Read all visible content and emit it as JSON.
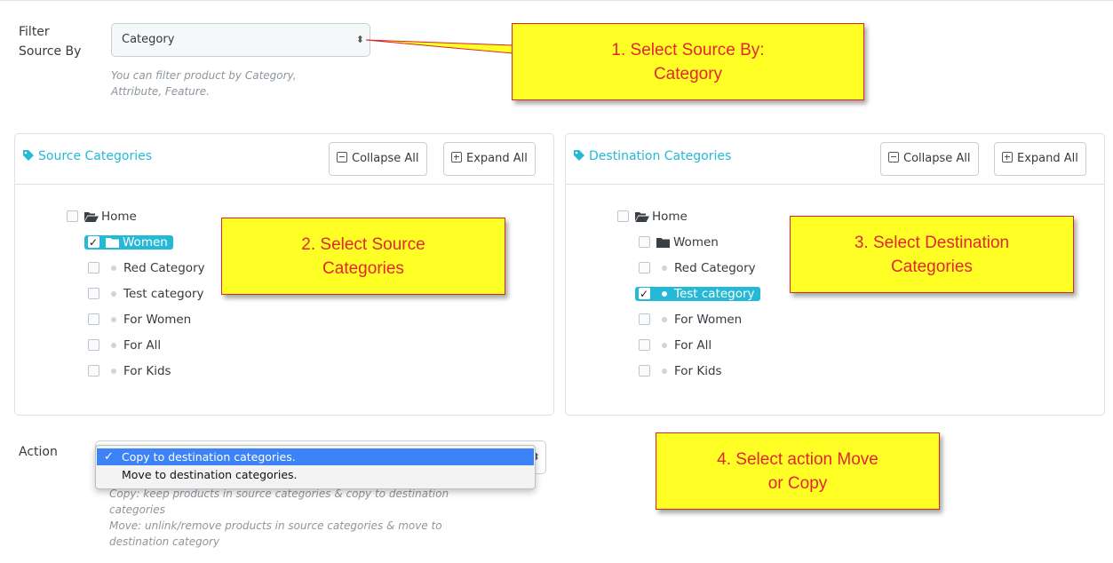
{
  "filter": {
    "label_line1": "Filter",
    "label_line2": "Source By",
    "select_value": "Category",
    "help_line1": "You can filter product by Category,",
    "help_line2": "Attribute, Feature."
  },
  "source_panel": {
    "title": "Source Categories",
    "collapse_label": "Collapse All",
    "expand_label": "Expand All",
    "tree": [
      {
        "label": "Home",
        "kind": "open-folder",
        "checked": false
      },
      {
        "label": "Women",
        "kind": "folder",
        "checked": true,
        "selected": true
      },
      {
        "label": "Red Category",
        "kind": "leaf",
        "checked": false
      },
      {
        "label": "Test category",
        "kind": "leaf",
        "checked": false
      },
      {
        "label": "For Women",
        "kind": "leaf",
        "checked": false
      },
      {
        "label": "For All",
        "kind": "leaf",
        "checked": false
      },
      {
        "label": "For Kids",
        "kind": "leaf",
        "checked": false
      }
    ]
  },
  "destination_panel": {
    "title": "Destination Categories",
    "collapse_label": "Collapse All",
    "expand_label": "Expand All",
    "tree": [
      {
        "label": "Home",
        "kind": "open-folder",
        "checked": false
      },
      {
        "label": "Women",
        "kind": "folder",
        "checked": false
      },
      {
        "label": "Red Category",
        "kind": "leaf",
        "checked": false
      },
      {
        "label": "Test category",
        "kind": "leaf",
        "checked": true,
        "selected": true
      },
      {
        "label": "For Women",
        "kind": "leaf",
        "checked": false
      },
      {
        "label": "For All",
        "kind": "leaf",
        "checked": false
      },
      {
        "label": "For Kids",
        "kind": "leaf",
        "checked": false
      }
    ]
  },
  "action": {
    "label": "Action",
    "options": [
      {
        "label": "Copy to destination categories.",
        "selected": true
      },
      {
        "label": "Move to destination categories.",
        "selected": false
      }
    ],
    "help_line1": "Copy: keep products in source categories & copy to destination",
    "help_line2": "categories",
    "help_line3": "Move: unlink/remove products in source categories & move to",
    "help_line4": "destination category"
  },
  "callouts": {
    "c1_line1": "1. Select Source By:",
    "c1_line2": "Category",
    "c2_line1": "2. Select Source",
    "c2_line2": "Categories",
    "c3_line1": "3. Select Destination",
    "c3_line2": "Categories",
    "c4_line1": "4. Select action Move",
    "c4_line2": "or Copy"
  },
  "colors": {
    "accent": "#25b9d7",
    "callout_bg": "#ffff26",
    "callout_text": "#e4262c",
    "dropdown_highlight": "#3d82f7"
  },
  "icons": {
    "select_arrows": "⬍",
    "tag": "tag-icon",
    "folder_open": "folder-open-icon",
    "folder": "folder-icon",
    "checkmark": "✓"
  }
}
